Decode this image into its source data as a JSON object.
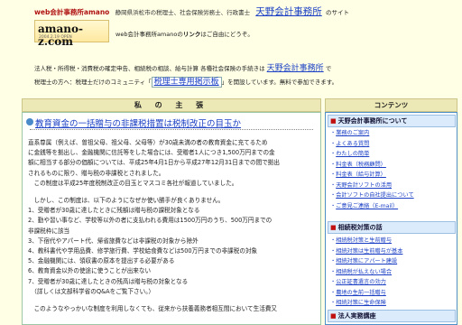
{
  "header": {
    "site_title": "web会計事務所amano",
    "description": "静岡県浜松市の税理士、社会保険労務士、行政書士",
    "office_link": "天野会計事務所",
    "suffix": "のサイト",
    "logo_text": "amano-z.com",
    "logo_sub": "2004.2.19 OPEN",
    "link_free_pre": "web会計事務所amanoの",
    "link_free_bold": "リンク",
    "link_free_post": "はご自由にどうぞ。"
  },
  "intro": {
    "line1_text": "法人税・所得税・消費税の確定申告、相続税の相談、給与計算 各種社会保険の手続きは",
    "line1_link": "天野会計事務所",
    "line1_after": "で",
    "line2_text": "税理士の方へ：税理士だけのコミュニティ「",
    "line2_link": "税理士専用掲示板",
    "line2_after": "」を開設しています。無料で参加できます。"
  },
  "main": {
    "header": "私 の 主 張",
    "article_title": "教育資金の一括贈与の非課税措置は税制改正の目玉か",
    "paragraphs": [
      "直系尊属（例えば、曽祖父母、祖父母、父母等）が30歳未満の者の教育資金に充てるため",
      "に金銭等を拠出し、金融機関に信託等をした場合には、受贈者1人につき1,500万円までの金",
      "額に相当する部分の価額については、平成25年4月1日から平成27年12月31日までの間で拠出",
      "されるものに限り、贈与税の非課税とされました。",
      "　この制度は平成25年度税制改正の目玉とマスコミ各社が報道していました。",
      "",
      "　しかし、この制度は、以下のようになぜか使い勝手が良くありません。",
      "1、受贈者が30歳に達したときに残額は贈与税の課税対象となる",
      "2、勤や習い事など、学校等以外の者に支払われる費用は1500万円のうち、500万円までの",
      "非課税枠に該当",
      "3、下宿代やアパート代、帰省旅費などは非課税の対象から除外",
      "4、教科書代や学用品費、修学旅行費、学校給食費などは500万円までの非課税の対象",
      "5、金融機関には、領収書の原本を提出する必要がある",
      "6、教育資金以外の使途に使うことが出来ない",
      "7、受贈者が30歳に達したときの残高は贈与税の対象となる",
      "　（詳しくは文部科学省のQ&Aをご覧下さい。）",
      "",
      "　このようなやっかいな制度を利用しなくても、従来から扶養義務者相互間において生活費又"
    ]
  },
  "sidebar": {
    "header": "コンテンツ",
    "section1": "天野会計事務所について",
    "items1": [
      "業務のご案内",
      "よくある質問",
      "わたしの簡単",
      "料金表（税務顧問）",
      "料金表（給与計算）",
      "天野会計ソフトの活用",
      "会計ソフトの自社提出について",
      "ご意見ご連絡（E-mail）"
    ],
    "section2": "相続税対策の話",
    "items2": [
      "相続税対策と生前贈与",
      "相続対策は生前贈与が基本",
      "相続対策にアパート建設",
      "相続税が払えない場合",
      "公正証書遺言の効力",
      "農地の生前一括贈与",
      "相続対策に生命保険",
      "生命保険による相続税対策"
    ],
    "section3": "法人実務講座"
  }
}
